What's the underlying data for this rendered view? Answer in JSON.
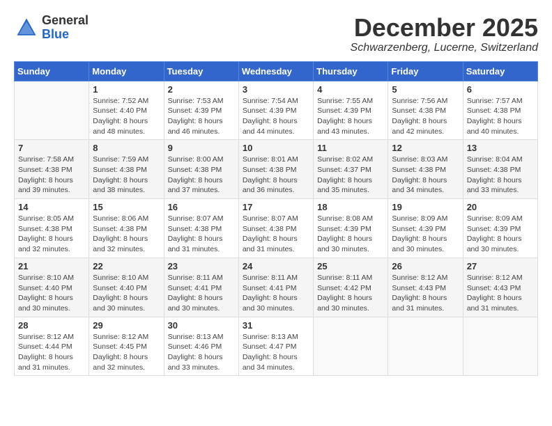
{
  "header": {
    "logo_general": "General",
    "logo_blue": "Blue",
    "month_title": "December 2025",
    "location": "Schwarzenberg, Lucerne, Switzerland"
  },
  "calendar": {
    "days_of_week": [
      "Sunday",
      "Monday",
      "Tuesday",
      "Wednesday",
      "Thursday",
      "Friday",
      "Saturday"
    ],
    "weeks": [
      [
        {
          "day": "",
          "info": ""
        },
        {
          "day": "1",
          "info": "Sunrise: 7:52 AM\nSunset: 4:40 PM\nDaylight: 8 hours\nand 48 minutes."
        },
        {
          "day": "2",
          "info": "Sunrise: 7:53 AM\nSunset: 4:39 PM\nDaylight: 8 hours\nand 46 minutes."
        },
        {
          "day": "3",
          "info": "Sunrise: 7:54 AM\nSunset: 4:39 PM\nDaylight: 8 hours\nand 44 minutes."
        },
        {
          "day": "4",
          "info": "Sunrise: 7:55 AM\nSunset: 4:39 PM\nDaylight: 8 hours\nand 43 minutes."
        },
        {
          "day": "5",
          "info": "Sunrise: 7:56 AM\nSunset: 4:38 PM\nDaylight: 8 hours\nand 42 minutes."
        },
        {
          "day": "6",
          "info": "Sunrise: 7:57 AM\nSunset: 4:38 PM\nDaylight: 8 hours\nand 40 minutes."
        }
      ],
      [
        {
          "day": "7",
          "info": "Sunrise: 7:58 AM\nSunset: 4:38 PM\nDaylight: 8 hours\nand 39 minutes."
        },
        {
          "day": "8",
          "info": "Sunrise: 7:59 AM\nSunset: 4:38 PM\nDaylight: 8 hours\nand 38 minutes."
        },
        {
          "day": "9",
          "info": "Sunrise: 8:00 AM\nSunset: 4:38 PM\nDaylight: 8 hours\nand 37 minutes."
        },
        {
          "day": "10",
          "info": "Sunrise: 8:01 AM\nSunset: 4:38 PM\nDaylight: 8 hours\nand 36 minutes."
        },
        {
          "day": "11",
          "info": "Sunrise: 8:02 AM\nSunset: 4:37 PM\nDaylight: 8 hours\nand 35 minutes."
        },
        {
          "day": "12",
          "info": "Sunrise: 8:03 AM\nSunset: 4:38 PM\nDaylight: 8 hours\nand 34 minutes."
        },
        {
          "day": "13",
          "info": "Sunrise: 8:04 AM\nSunset: 4:38 PM\nDaylight: 8 hours\nand 33 minutes."
        }
      ],
      [
        {
          "day": "14",
          "info": "Sunrise: 8:05 AM\nSunset: 4:38 PM\nDaylight: 8 hours\nand 32 minutes."
        },
        {
          "day": "15",
          "info": "Sunrise: 8:06 AM\nSunset: 4:38 PM\nDaylight: 8 hours\nand 32 minutes."
        },
        {
          "day": "16",
          "info": "Sunrise: 8:07 AM\nSunset: 4:38 PM\nDaylight: 8 hours\nand 31 minutes."
        },
        {
          "day": "17",
          "info": "Sunrise: 8:07 AM\nSunset: 4:38 PM\nDaylight: 8 hours\nand 31 minutes."
        },
        {
          "day": "18",
          "info": "Sunrise: 8:08 AM\nSunset: 4:39 PM\nDaylight: 8 hours\nand 30 minutes."
        },
        {
          "day": "19",
          "info": "Sunrise: 8:09 AM\nSunset: 4:39 PM\nDaylight: 8 hours\nand 30 minutes."
        },
        {
          "day": "20",
          "info": "Sunrise: 8:09 AM\nSunset: 4:39 PM\nDaylight: 8 hours\nand 30 minutes."
        }
      ],
      [
        {
          "day": "21",
          "info": "Sunrise: 8:10 AM\nSunset: 4:40 PM\nDaylight: 8 hours\nand 30 minutes."
        },
        {
          "day": "22",
          "info": "Sunrise: 8:10 AM\nSunset: 4:40 PM\nDaylight: 8 hours\nand 30 minutes."
        },
        {
          "day": "23",
          "info": "Sunrise: 8:11 AM\nSunset: 4:41 PM\nDaylight: 8 hours\nand 30 minutes."
        },
        {
          "day": "24",
          "info": "Sunrise: 8:11 AM\nSunset: 4:41 PM\nDaylight: 8 hours\nand 30 minutes."
        },
        {
          "day": "25",
          "info": "Sunrise: 8:11 AM\nSunset: 4:42 PM\nDaylight: 8 hours\nand 30 minutes."
        },
        {
          "day": "26",
          "info": "Sunrise: 8:12 AM\nSunset: 4:43 PM\nDaylight: 8 hours\nand 31 minutes."
        },
        {
          "day": "27",
          "info": "Sunrise: 8:12 AM\nSunset: 4:43 PM\nDaylight: 8 hours\nand 31 minutes."
        }
      ],
      [
        {
          "day": "28",
          "info": "Sunrise: 8:12 AM\nSunset: 4:44 PM\nDaylight: 8 hours\nand 31 minutes."
        },
        {
          "day": "29",
          "info": "Sunrise: 8:12 AM\nSunset: 4:45 PM\nDaylight: 8 hours\nand 32 minutes."
        },
        {
          "day": "30",
          "info": "Sunrise: 8:13 AM\nSunset: 4:46 PM\nDaylight: 8 hours\nand 33 minutes."
        },
        {
          "day": "31",
          "info": "Sunrise: 8:13 AM\nSunset: 4:47 PM\nDaylight: 8 hours\nand 34 minutes."
        },
        {
          "day": "",
          "info": ""
        },
        {
          "day": "",
          "info": ""
        },
        {
          "day": "",
          "info": ""
        }
      ]
    ]
  }
}
